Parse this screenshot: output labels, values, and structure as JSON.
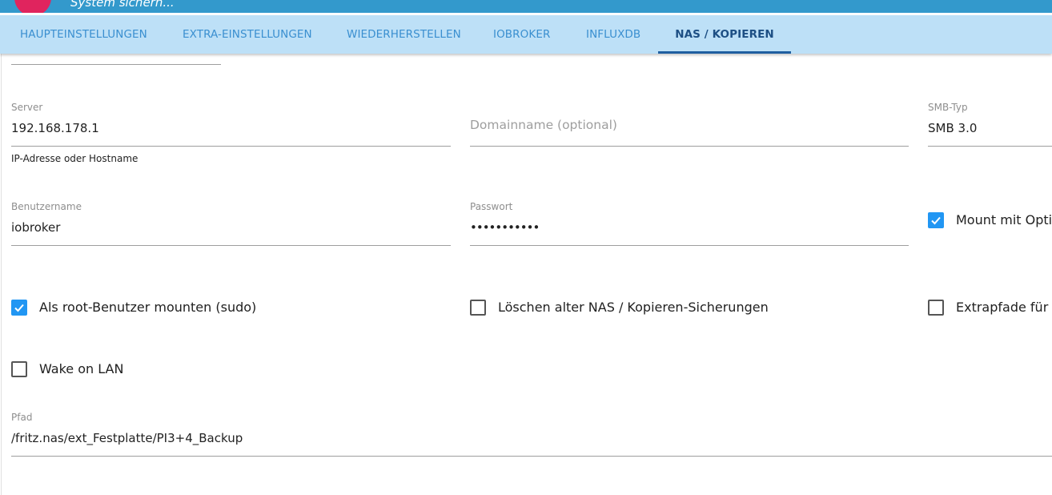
{
  "header": {
    "subtitle": "System sichern..."
  },
  "tabs": [
    {
      "label": "HAUPTEINSTELLUNGEN",
      "active": false
    },
    {
      "label": "EXTRA-EINSTELLUNGEN",
      "active": false
    },
    {
      "label": "WIEDERHERSTELLEN",
      "active": false
    },
    {
      "label": "IOBROKER",
      "active": false
    },
    {
      "label": "INFLUXDB",
      "active": false
    },
    {
      "label": "NAS / KOPIEREN",
      "active": true
    }
  ],
  "form": {
    "server": {
      "label": "Server",
      "value": "192.168.178.1",
      "helper": "IP-Adresse oder Hostname"
    },
    "domain": {
      "placeholder": "Domainname (optional)",
      "value": ""
    },
    "smb_type": {
      "label": "SMB-Typ",
      "value": "SMB 3.0"
    },
    "username": {
      "label": "Benutzername",
      "value": "iobroker"
    },
    "password": {
      "label": "Passwort",
      "value": "•••••••••••"
    },
    "checkboxes": {
      "mount_options": {
        "label": "Mount mit Optio",
        "checked": true
      },
      "sudo": {
        "label": "Als root-Benutzer mounten (sudo)",
        "checked": true
      },
      "delete_old": {
        "label": "Löschen alter NAS / Kopieren-Sicherungen",
        "checked": false
      },
      "extra_paths": {
        "label": "Extrapfade für a",
        "checked": false
      },
      "wake_on_lan": {
        "label": "Wake on LAN",
        "checked": false
      }
    },
    "path": {
      "label": "Pfad",
      "value": "/fritz.nas/ext_Festplatte/PI3+4_Backup"
    }
  },
  "colors": {
    "accent": "#2196f3",
    "tab_bar": "#bde0f7",
    "top_bar": "#3399cc",
    "logo": "#e0245e"
  }
}
